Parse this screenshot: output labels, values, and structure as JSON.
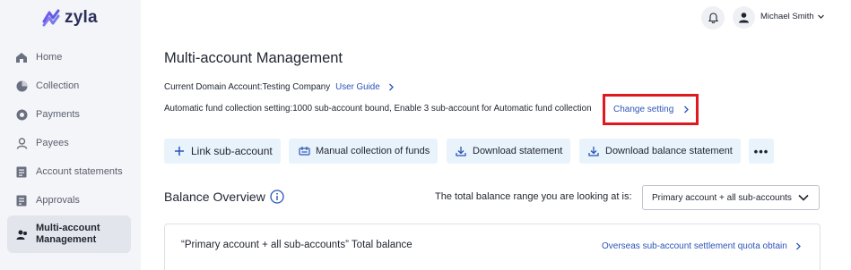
{
  "brand": {
    "name": "zyla"
  },
  "sidebar": {
    "items": [
      {
        "label": "Home",
        "icon": "home-icon"
      },
      {
        "label": "Collection",
        "icon": "pie-chart-icon"
      },
      {
        "label": "Payments",
        "icon": "payment-icon"
      },
      {
        "label": "Payees",
        "icon": "payees-icon"
      },
      {
        "label": "Account statements",
        "icon": "statement-icon"
      },
      {
        "label": "Approvals",
        "icon": "approval-icon"
      },
      {
        "label": "Multi-account Management",
        "icon": "multi-account-icon",
        "active": true
      }
    ]
  },
  "header": {
    "user_name": "Michael Smith"
  },
  "main": {
    "title": "Multi-account Management",
    "domain_account_label": "Current Domain Account:Testing Company",
    "user_guide": "User Guide",
    "fund_collection_text": "Automatic fund collection setting:1000 sub-account bound,  Enable 3 sub-account for Automatic fund collection",
    "change_setting": "Change setting",
    "actions": {
      "link_sub_account": "Link sub-account",
      "manual_collection": "Manual collection of funds",
      "download_statement": "Download statement",
      "download_balance_statement": "Download balance statement",
      "more": "•••"
    },
    "balance": {
      "title": "Balance Overview",
      "range_label": "The total balance range you are looking at is:",
      "range_value": "Primary account + all sub-accounts",
      "card_title": "“Primary account + all sub-accounts” Total balance",
      "quota_link": "Overseas sub-account settlement quota obtain"
    }
  },
  "colors": {
    "accent": "#2c54b8",
    "button_bg": "#e9f3fb",
    "highlight_border": "#e0181f",
    "sidebar_bg": "#f4f5f8"
  }
}
